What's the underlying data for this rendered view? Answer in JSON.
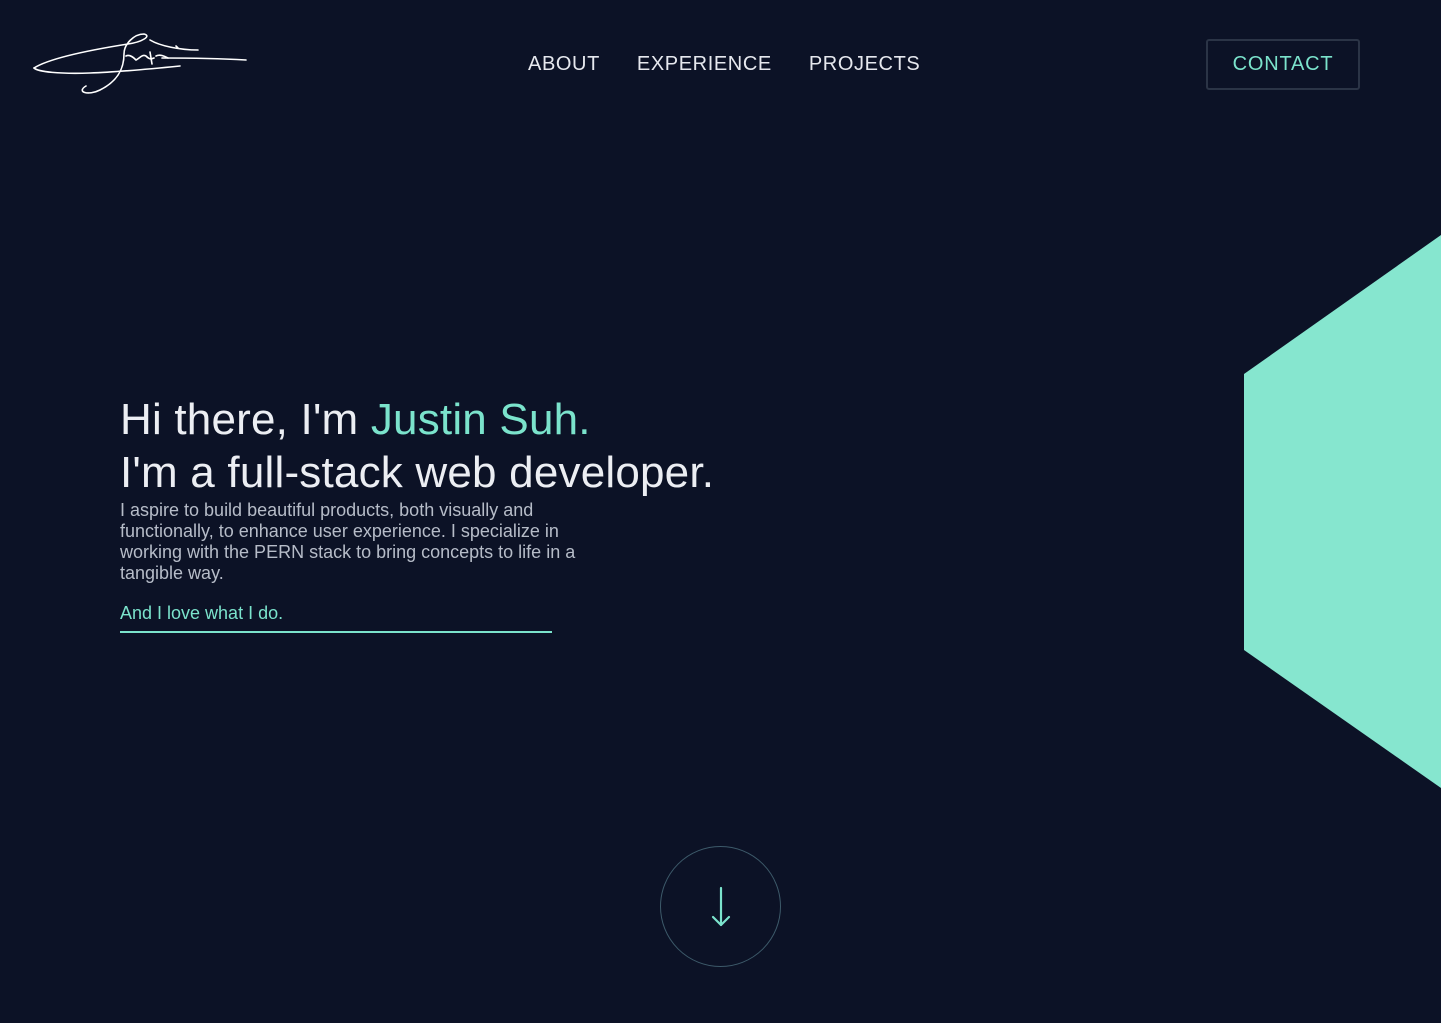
{
  "colors": {
    "background": "#0c1226",
    "accent": "#7be3cc",
    "text": "#eceef3",
    "muted": "#b6bcc8",
    "hexagon": "#86e6cf"
  },
  "header": {
    "logo_icon": "signature-logo-icon",
    "nav": [
      {
        "label": "ABOUT"
      },
      {
        "label": "EXPERIENCE"
      },
      {
        "label": "PROJECTS"
      }
    ],
    "contact_label": "CONTACT"
  },
  "hero": {
    "greeting_prefix": "Hi there, I'm ",
    "name": "Justin Suh.",
    "headline": "I'm a full-stack web developer.",
    "description": "I aspire to build beautiful products, both visually and functionally, to enhance user experience. I specialize in working with the PERN stack to bring concepts to life in a tangible way.",
    "love_link": "And I love what I do."
  },
  "scroll": {
    "icon": "arrow-down-icon"
  },
  "decoration": {
    "shape": "hexagon-shape"
  }
}
